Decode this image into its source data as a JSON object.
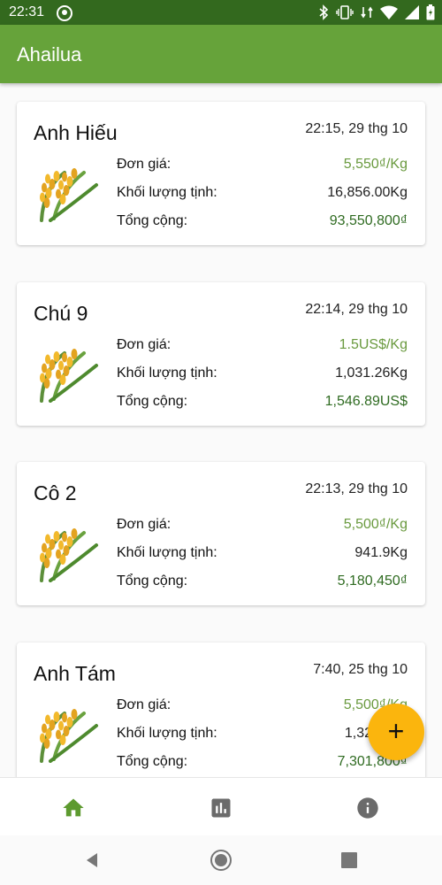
{
  "status_bar": {
    "time": "22:31"
  },
  "app_bar": {
    "title": "Ahailua"
  },
  "labels": {
    "price": "Đơn giá:",
    "weight": "Khối lượng tịnh:",
    "total": "Tổng cộng:"
  },
  "entries": [
    {
      "name": "Anh Hiếu",
      "time": "22:15, 29 thg 10",
      "price": "5,550₫/Kg",
      "weight": "16,856.00Kg",
      "total": "93,550,800₫"
    },
    {
      "name": "Chú 9",
      "time": "22:14, 29 thg 10",
      "price": "1.5US$/Kg",
      "weight": "1,031.26Kg",
      "total": "1,546.89US$"
    },
    {
      "name": "Cô 2",
      "time": "22:13, 29 thg 10",
      "price": "5,500₫/Kg",
      "weight": "941.9Kg",
      "total": "5,180,450₫"
    },
    {
      "name": "Anh Tám",
      "time": "7:40, 25 thg 10",
      "price": "5,500₫/Kg",
      "weight": "1,32",
      "total": "7,301,800₫"
    }
  ],
  "fab": {
    "label": "+",
    "icon": "plus-icon"
  },
  "bottom_nav": {
    "items": [
      {
        "icon": "home-icon",
        "active": true
      },
      {
        "icon": "bar-chart-icon"
      },
      {
        "icon": "info-icon"
      }
    ]
  },
  "system_nav": {
    "items": [
      "back-icon",
      "home-circle-icon",
      "recents-icon"
    ]
  },
  "colors": {
    "status_bar": "#33691e",
    "app_bar": "#66a33a",
    "fab": "#fbb50d",
    "price": "#6a9a3f",
    "total": "#2f6b21"
  }
}
